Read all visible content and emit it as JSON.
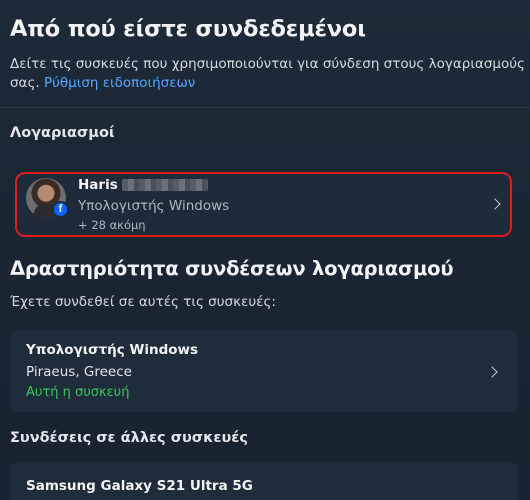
{
  "header": {
    "title": "Από πού είστε συνδεδεμένοι",
    "description": "Δείτε τις συσκευές που χρησιμοποιούνται για σύνδεση στους λογαριασμούς σας.",
    "notifications_link": "Ρύθμιση ειδοποιήσεων"
  },
  "accounts": {
    "label": "Λογαριασμοί",
    "card": {
      "name": "Haris",
      "device": "Υπολογιστής Windows",
      "more": "+ 28 ακόμη",
      "badge_icon": "facebook-icon",
      "highlight_color": "#e21c1c"
    }
  },
  "activity": {
    "title": "Δραστηριότητα συνδέσεων λογαριασμού",
    "subtitle": "Έχετε συνδεθεί σε αυτές τις συσκευές:",
    "current_device": {
      "name": "Υπολογιστής Windows",
      "location": "Piraeus, Greece",
      "status": "Αυτή η συσκευή",
      "status_color": "#37c85a"
    },
    "other_label": "Συνδέσεις σε άλλες συσκευές",
    "other_devices": [
      {
        "name": "Samsung Galaxy S21 Ultra 5G"
      }
    ]
  },
  "colors": {
    "background": "#1a2634",
    "card": "#1f2c3b",
    "link": "#5aa7ff"
  }
}
